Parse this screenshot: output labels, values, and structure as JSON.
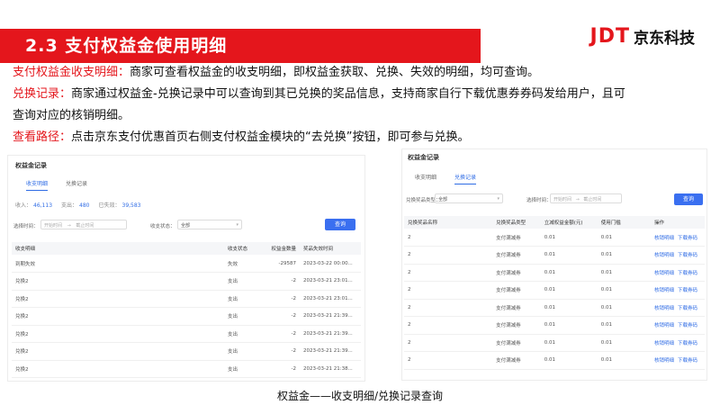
{
  "header": {
    "title": "2.3 支付权益金使用明细",
    "logo_mark": "JDT",
    "logo_text": "京东科技"
  },
  "paragraphs": [
    {
      "label": "支付权益金收支明细：",
      "text": "商家可查看权益金的收支明细，即权益金获取、兑换、失效的明细，均可查询。"
    },
    {
      "label": "兑换记录：",
      "text": "商家通过权益金-兑换记录中可以查询到其已兑换的奖品信息，支持商家自行下载优惠券券码发给用户，且可"
    },
    {
      "label": "",
      "text": "查询对应的核销明细。"
    },
    {
      "label": "查看路径：",
      "text": "点击京东支付优惠首页右侧支付权益金模块的“去兑换”按钮，即可参与兑换。"
    }
  ],
  "left_panel": {
    "title": "权益金记录",
    "tabs": [
      "收支明细",
      "兑换记录"
    ],
    "stats": [
      {
        "label": "收入：",
        "value": "46,113"
      },
      {
        "label": "支出：",
        "value": "480"
      },
      {
        "label": "已失效：",
        "value": "39,583"
      }
    ],
    "filters": {
      "time_label": "选择时间：",
      "start_placeholder": "开始时间",
      "end_placeholder": "截止时间",
      "status_label": "收支状态：",
      "status_value": "全部"
    },
    "search_label": "查询",
    "columns": [
      "收支明细",
      "收支状态",
      "权益金数量",
      "奖品失效时间"
    ],
    "rows": [
      [
        "到期失效",
        "失效",
        "-29587",
        "2023-03-22 00:00..."
      ],
      [
        "兑换2",
        "支出",
        "-2",
        "2023-03-21 23:01..."
      ],
      [
        "兑换2",
        "支出",
        "-2",
        "2023-03-21 23:01..."
      ],
      [
        "兑换2",
        "支出",
        "-2",
        "2023-03-21 21:39..."
      ],
      [
        "兑换2",
        "支出",
        "-2",
        "2023-03-21 21:39..."
      ],
      [
        "兑换2",
        "支出",
        "-2",
        "2023-03-21 21:39..."
      ],
      [
        "兑换2",
        "支出",
        "-2",
        "2023-03-21 21:38..."
      ]
    ]
  },
  "right_panel": {
    "title": "权益金记录",
    "tabs": [
      "收支明细",
      "兑换记录"
    ],
    "filters": {
      "type_label": "兑换奖品类型：",
      "type_value": "全部",
      "time_label": "选择时间：",
      "start_placeholder": "开始时间",
      "end_placeholder": "截止时间"
    },
    "search_label": "查询",
    "columns": [
      "兑换奖品名称",
      "兑换奖品类型",
      "立减权益金额(元)",
      "使用门槛",
      "操作"
    ],
    "actions": [
      "核销明细",
      "下载券码"
    ],
    "rows": [
      [
        "2",
        "支付满减券",
        "0.01",
        "0.01"
      ],
      [
        "2",
        "支付满减券",
        "0.01",
        "0.01"
      ],
      [
        "2",
        "支付满减券",
        "0.01",
        "0.01"
      ],
      [
        "2",
        "支付满减券",
        "0.01",
        "0.01"
      ],
      [
        "2",
        "支付满减券",
        "0.01",
        "0.01"
      ],
      [
        "2",
        "支付满减券",
        "0.01",
        "0.01"
      ],
      [
        "2",
        "支付满减券",
        "0.01",
        "0.01"
      ],
      [
        "2",
        "支付满减券",
        "0.01",
        "0.01"
      ]
    ]
  },
  "caption": "权益金——收支明细/兑换记录查询"
}
